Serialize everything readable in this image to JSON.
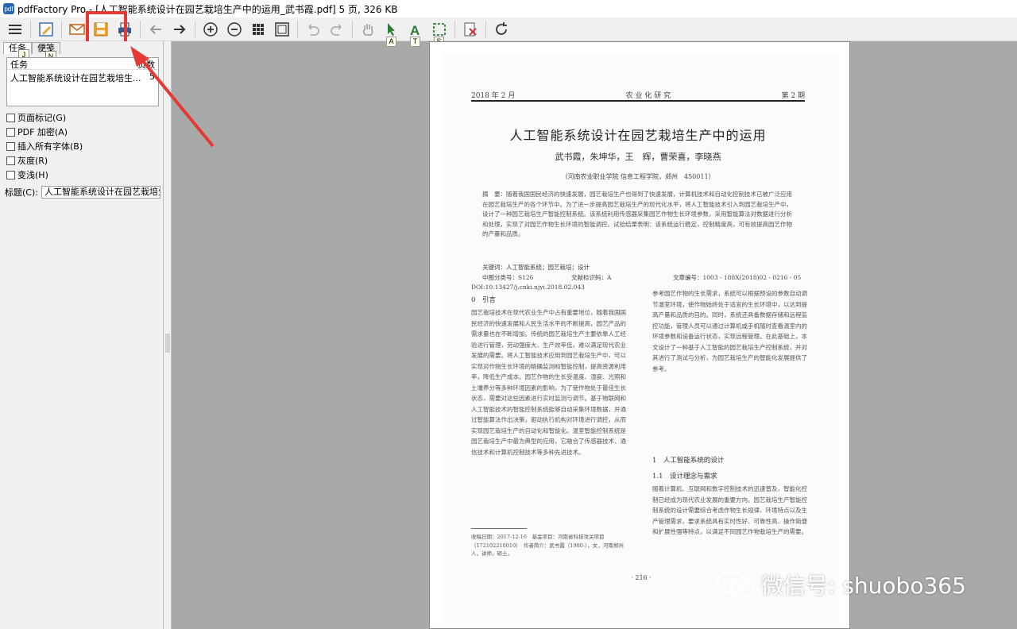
{
  "window": {
    "title": "pdfFactory Pro - [人工智能系统设计在园艺栽培生产中的运用_武书霞.pdf] 5 页, 326 KB",
    "app_icon_text": "pdf"
  },
  "toolbar": {
    "badges": {
      "select_text": "A",
      "text_tool": "T",
      "snapshot": "S"
    },
    "accent_color": "#e53935"
  },
  "left_panel": {
    "tabs": [
      {
        "label": "任务",
        "hint": "J"
      },
      {
        "label": "便笺",
        "hint": "N"
      }
    ],
    "task_list": {
      "col_task": "任务",
      "col_pages": "页数",
      "rows": [
        {
          "name": "人工智能系统设计在园艺栽培生...",
          "pages": "5"
        }
      ]
    },
    "options": [
      "页面标记(G)",
      "PDF 加密(A)",
      "插入所有字体(B)",
      "灰度(R)",
      "变浅(H)"
    ],
    "title_label": "标题(C):",
    "title_value": "人工智能系统设计在园艺栽培生产"
  },
  "document": {
    "header_left": "2018 年 2 月",
    "header_center": "农 业 化 研 究",
    "header_right": "第 2 期",
    "title": "人工智能系统设计在园艺栽培生产中的运用",
    "authors": "武书霞，朱坤华，王　辉，曹荣喜，李晓燕",
    "affiliation": "（河南农业职业学院 信息工程学院，郑州　450011）",
    "abstract": "摘　要：随着我国国民经济的快速发展，园艺栽培生产也得到了快速发展，计算机技术和自动化控制技术已被广泛应用在园艺栽培生产的各个环节中。为了进一步提高园艺栽培生产的现代化水平，将人工智能技术引入到园艺栽培生产中，设计了一种园艺栽培生产智能控制系统。该系统利用传感器采集园艺作物生长环境参数，采用智能算法对数据进行分析和处理，实现了对园艺作物生长环境的智能调控。试验结果表明：该系统运行稳定，控制精度高，可有效提高园艺作物的产量和品质。",
    "keywords": "关键词：人工智能系统；园艺栽培；设计",
    "clc": "中图分类号：S126",
    "doc_code": "文献标识码：A",
    "article_no": "文章编号：1003 - 188X(2018)02 - 0216 - 05",
    "doi": "DOI:10.13427/j.cnki.njyi.2018.02.043",
    "sec0": "0　引言",
    "col_left": "园艺栽培技术在现代农业生产中占有重要地位，随着我国国民经济的快速发展和人民生活水平的不断提高，园艺产品的需求量也在不断增加。传统的园艺栽培生产主要依靠人工经验进行管理，劳动强度大、生产效率低，难以满足现代农业发展的需要。将人工智能技术应用到园艺栽培生产中，可以实现对作物生长环境的精确监测和智能控制，提高资源利用率，降低生产成本。园艺作物的生长受温度、湿度、光照和土壤养分等多种环境因素的影响，为了使作物处于最佳生长状态，需要对这些因素进行实时监测与调节。基于物联网和人工智能技术的智能控制系统能够自动采集环境数据，并通过智能算法作出决策，驱动执行机构对环境进行调控，从而实现园艺栽培生产的自动化和智能化。温室智能控制系统是园艺栽培生产中最为典型的应用，它融合了传感器技术、通信技术和计算机控制技术等多种先进技术。",
    "col_right": "参考园艺作物的生长需求，系统可以根据预设的参数自动调节温室环境，使作物始终处于适宜的生长环境中，以达到提高产量和品质的目的。同时，系统还具备数据存储和远程监控功能，管理人员可以通过计算机或手机随时查看温室内的环境参数和设备运行状态，实现远程管理。在此基础上，本文设计了一种基于人工智能的园艺栽培生产控制系统，并对其进行了测试与分析，为园艺栽培生产的智能化发展提供了参考。",
    "sec1": "1　人工智能系统的设计",
    "sec11": "1.1　设计理念与需求",
    "col_right2": "随着计算机、互联网和数字控制技术的迅速普及，智能化控制已经成为现代农业发展的重要方向。园艺栽培生产智能控制系统的设计需要综合考虑作物生长规律、环境特点以及生产管理需求，要求系统具有实时性好、可靠性高、操作简便和扩展性强等特点，以满足不同园艺作物栽培生产的需要。",
    "footnote": "收稿日期：2017-12-16　基金项目：河南省科技攻关项目（172102210010）　作者简介：武书霞（1980-），女，河南郑州人，讲师，硕士。",
    "page_number": "· 216 ·"
  },
  "watermark": {
    "text": "微信号: shuobo365"
  }
}
